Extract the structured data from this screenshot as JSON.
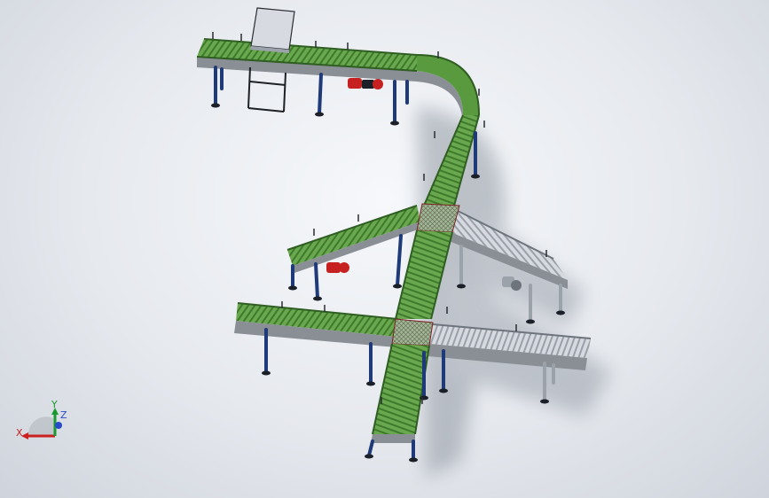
{
  "triad": {
    "x_label": "X",
    "y_label": "Y",
    "z_label": "Z"
  },
  "colors": {
    "conveyor_green": "#5a9a3e",
    "conveyor_grey": "#c7ccd3",
    "frame_steel": "#8a8f96",
    "leg_blue": "#1f3a78",
    "motor_red": "#c62020",
    "axis_x": "#cc1f1f",
    "axis_y": "#1a9a2e",
    "axis_z": "#2a4acc"
  }
}
